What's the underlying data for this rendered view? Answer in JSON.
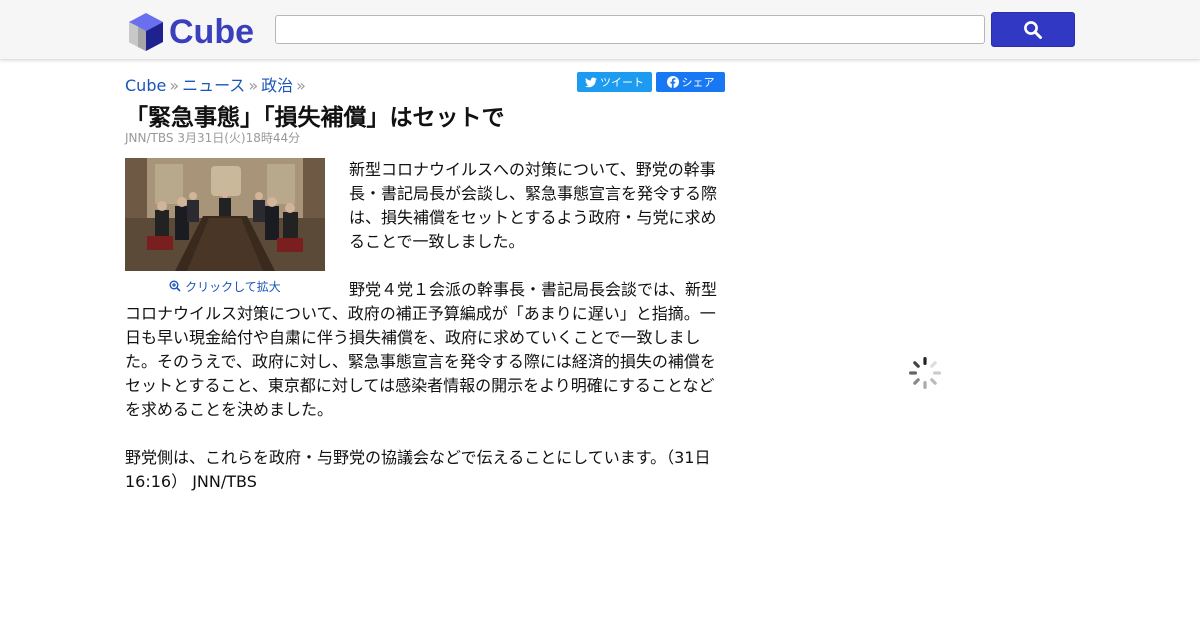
{
  "header": {
    "logo_text": "Cube",
    "search_placeholder": "",
    "search_icon": "search-icon",
    "brand_color": "#3138c4"
  },
  "breadcrumb": {
    "items": [
      "Cube",
      "ニュース",
      "政治"
    ],
    "separator": "»"
  },
  "share": {
    "tweet_label": "ツイート",
    "facebook_label": "シェア"
  },
  "article": {
    "title": "「緊急事態」「損失補償」はセットで",
    "meta": "JNN/TBS 3月31日(火)18時44分",
    "image_caption": "クリックして拡大",
    "paragraphs": [
      "新型コロナウイルスへの対策について、野党の幹事長・書記局長が会談し、緊急事態宣言を発令する際は、損失補償をセットとするよう政府・与党に求めることで一致しました。",
      "野党４党１会派の幹事長・書記局長会談では、新型コロナウイルス対策について、政府の補正予算編成が「あまりに遅い」と指摘。一日も早い現金給付や自粛に伴う損失補償を、政府に求めていくことで一致しました。そのうえで、政府に対し、緊急事態宣言を発令する際には経済的損失の補償をセットとすること、東京都に対しては感染者情報の開示をより明確にすることなどを求めることを決めました。",
      "野党側は、これらを政府・与野党の協議会などで伝えることにしています。（31日16:16） JNN/TBS"
    ]
  }
}
